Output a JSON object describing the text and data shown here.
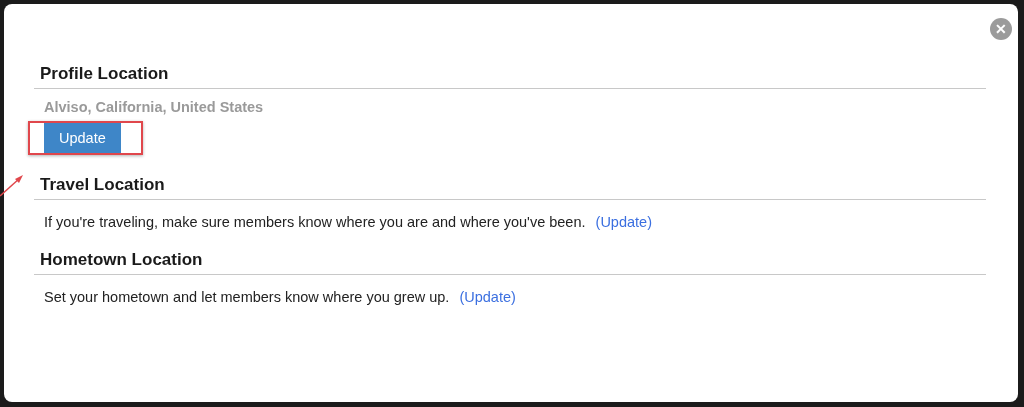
{
  "dialog": {
    "close_label": "✕",
    "sections": [
      {
        "kind": "current",
        "heading": "Profile Location",
        "value": "Alviso, California, United States",
        "button": "Update",
        "highlighted": true
      },
      {
        "kind": "prompt",
        "heading": "Travel Location",
        "text": "If you're traveling, make sure members know where you are and where you've been.",
        "link": "(Update)"
      },
      {
        "kind": "prompt",
        "heading": "Hometown Location",
        "text": "Set your hometown and let members know where you grew up.",
        "link": "(Update)"
      }
    ]
  }
}
